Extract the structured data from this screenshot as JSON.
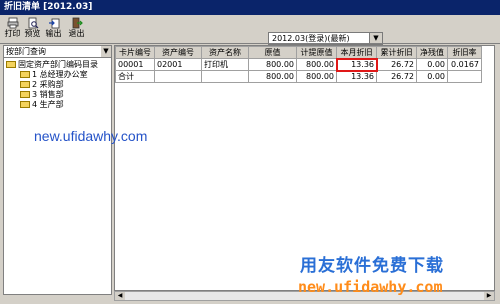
{
  "window": {
    "title": "折旧清单 [2012.03]"
  },
  "toolbar": {
    "buttons": [
      {
        "label": "打印",
        "icon": "printer-icon"
      },
      {
        "label": "预览",
        "icon": "preview-icon"
      },
      {
        "label": "输出",
        "icon": "export-icon"
      },
      {
        "label": "退出",
        "icon": "exit-icon"
      }
    ]
  },
  "period_select": {
    "value": "2012.03(登录)(最新)"
  },
  "left_panel": {
    "query_by": "按部门查询",
    "tree_root": "固定资产部门编码目录",
    "tree_items": [
      "1 总经理办公室",
      "2 采购部",
      "3 销售部",
      "4 生产部"
    ]
  },
  "table": {
    "columns": [
      "卡片编号",
      "资产编号",
      "资产名称",
      "原值",
      "计提原值",
      "本月折旧",
      "累计折旧",
      "净残值",
      "折旧率"
    ],
    "rows": [
      [
        "00001",
        "02001",
        "打印机",
        "800.00",
        "800.00",
        "13.36",
        "26.72",
        "0.00",
        "0.0167"
      ],
      [
        "合计",
        "",
        "",
        "800.00",
        "800.00",
        "13.36",
        "26.72",
        "0.00",
        ""
      ]
    ]
  },
  "watermarks": {
    "url_top": "new.ufidawhy.com",
    "slogan": "用友软件免费下载",
    "url_bottom": "new.ufidawhy.com"
  }
}
